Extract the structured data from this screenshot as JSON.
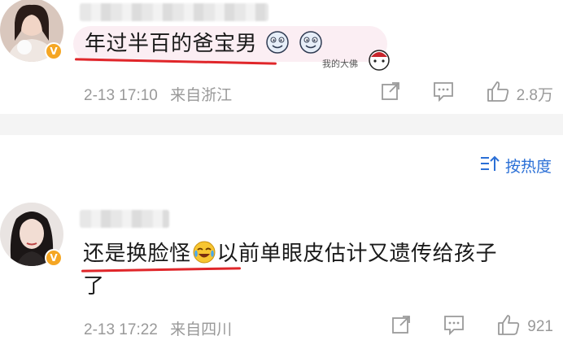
{
  "comments": [
    {
      "text": "年过半百的爸宝男",
      "highlight": "年过半百的爸宝男",
      "badge": "V",
      "sticker_text": "我的大佛",
      "date": "2-13 17:10",
      "location": "来自浙江",
      "likes": "2.8万"
    },
    {
      "highlight": "还是换脸怪",
      "rest": "以前单眼皮估计又遗传给孩子",
      "wrap": "了",
      "badge": "V",
      "date": "2-13 17:22",
      "location": "来自四川",
      "likes": "921"
    }
  ],
  "sort": {
    "label": "按热度"
  },
  "colors": {
    "underline": "#e0262a",
    "badge": "#f5a623",
    "link": "#2a6fd6",
    "meta": "#999999"
  },
  "icons": [
    "share-icon",
    "comment-icon",
    "like-icon",
    "sort-icon",
    "laugh-cry-emoji",
    "face-emoji",
    "verified-badge"
  ]
}
